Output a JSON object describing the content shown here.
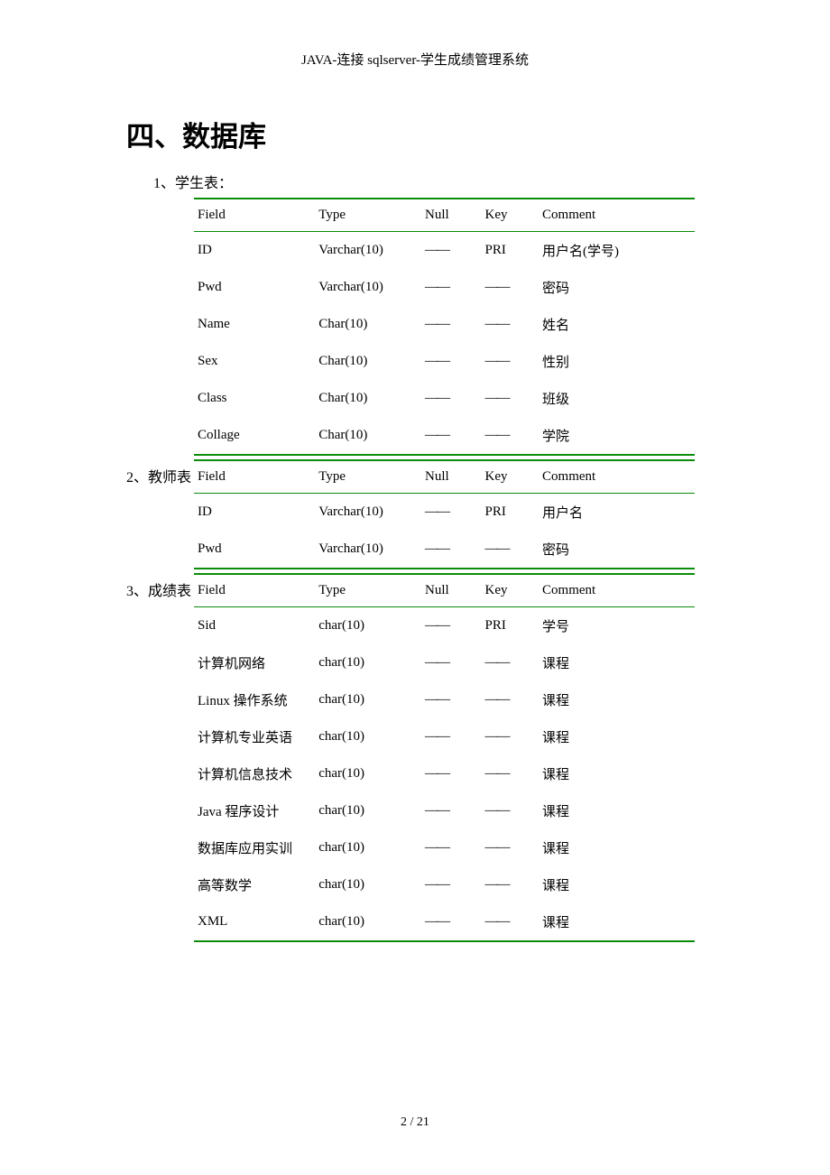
{
  "header": "JAVA-连接 sqlserver-学生成绩管理系统",
  "heading": "四、数据库",
  "sections": [
    {
      "label": "1、学生表：",
      "labelInline": false,
      "headers": {
        "field": "Field",
        "type": "Type",
        "null": "Null",
        "key": "Key",
        "comment": "Comment"
      },
      "rows": [
        {
          "field": "ID",
          "type": "Varchar(10)",
          "null": "——",
          "key": "PRI",
          "comment": "用户名(学号)"
        },
        {
          "field": "Pwd",
          "type": "Varchar(10)",
          "null": "——",
          "key": "——",
          "comment": "密码"
        },
        {
          "field": "Name",
          "type": "Char(10)",
          "null": "——",
          "key": "——",
          "comment": "姓名"
        },
        {
          "field": "Sex",
          "type": "Char(10)",
          "null": "——",
          "key": "——",
          "comment": "性别"
        },
        {
          "field": "Class",
          "type": "Char(10)",
          "null": "——",
          "key": "——",
          "comment": "班级"
        },
        {
          "field": "Collage",
          "type": "Char(10)",
          "null": "——",
          "key": "——",
          "comment": "学院"
        }
      ]
    },
    {
      "label": "2、教师表",
      "labelInline": true,
      "headers": {
        "field": "Field",
        "type": "Type",
        "null": "Null",
        "key": "Key",
        "comment": "Comment"
      },
      "rows": [
        {
          "field": "ID",
          "type": "Varchar(10)",
          "null": "——",
          "key": "PRI",
          "comment": "用户名"
        },
        {
          "field": "Pwd",
          "type": "Varchar(10)",
          "null": "——",
          "key": "——",
          "comment": "密码"
        }
      ]
    },
    {
      "label": "3、成绩表",
      "labelInline": true,
      "headers": {
        "field": "Field",
        "type": "Type",
        "null": "Null",
        "key": "Key",
        "comment": "Comment"
      },
      "rows": [
        {
          "field": "Sid",
          "type": "char(10)",
          "null": "——",
          "key": "PRI",
          "comment": "学号"
        },
        {
          "field": "计算机网络",
          "type": "char(10)",
          "null": "——",
          "key": "——",
          "comment": "课程"
        },
        {
          "field": "Linux 操作系统",
          "type": "char(10)",
          "null": "——",
          "key": "——",
          "comment": "课程"
        },
        {
          "field": "计算机专业英语",
          "type": "char(10)",
          "null": "——",
          "key": "——",
          "comment": "课程"
        },
        {
          "field": "计算机信息技术",
          "type": "char(10)",
          "null": "——",
          "key": "——",
          "comment": "课程"
        },
        {
          "field": "Java 程序设计",
          "type": "char(10)",
          "null": "——",
          "key": "——",
          "comment": "课程"
        },
        {
          "field": "数据库应用实训",
          "type": "char(10)",
          "null": "——",
          "key": "——",
          "comment": "课程"
        },
        {
          "field": "高等数学",
          "type": "char(10)",
          "null": "——",
          "key": "——",
          "comment": "课程"
        },
        {
          "field": "XML",
          "type": "char(10)",
          "null": "——",
          "key": "——",
          "comment": "课程"
        }
      ]
    }
  ],
  "footer": "2 / 21"
}
